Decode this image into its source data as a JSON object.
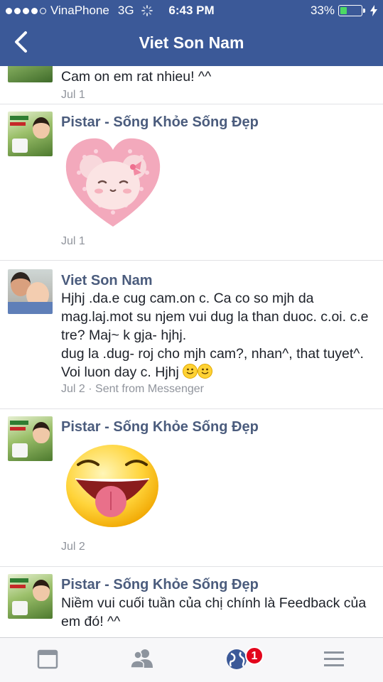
{
  "status_bar": {
    "carrier": "VinaPhone",
    "network": "3G",
    "time": "6:43 PM",
    "battery": "33%",
    "battery_level": 0.33
  },
  "nav": {
    "title": "Viet Son Nam"
  },
  "messages": [
    {
      "text": "Cam on em rat nhieu! ^^",
      "date": "Jul 1"
    },
    {
      "name": "Pistar - Sống Khỏe Sống Đẹp",
      "date": "Jul 1",
      "sticker": "pink-bear-heart-sticker"
    },
    {
      "name": "Viet Son Nam",
      "text": "Hjhj .da.e cug cam.on c. Ca co so mjh da mag.laj.mot su njem vui dug la than duoc. c.oi. c.e tre? Maj~ k gja- hjhj.",
      "text2": "dug la .dug- roj cho mjh cam?, nhan^, that tuyet^. Voi luon day c. Hjhj",
      "date": "Jul 2 · Sent from Messenger"
    },
    {
      "name": "Pistar - Sống Khỏe Sống Đẹp",
      "date": "Jul 2",
      "sticker": "tongue-out-emoji-sticker"
    },
    {
      "name": "Pistar - Sống Khỏe Sống Đẹp",
      "text": "Niềm vui cuối tuần của chị chính là Feedback của em đó! ^^"
    }
  ],
  "tabbar": {
    "notification_count": "1"
  },
  "colors": {
    "header": "#3b5998",
    "name": "#4b5c7d",
    "badge": "#e3051c"
  }
}
